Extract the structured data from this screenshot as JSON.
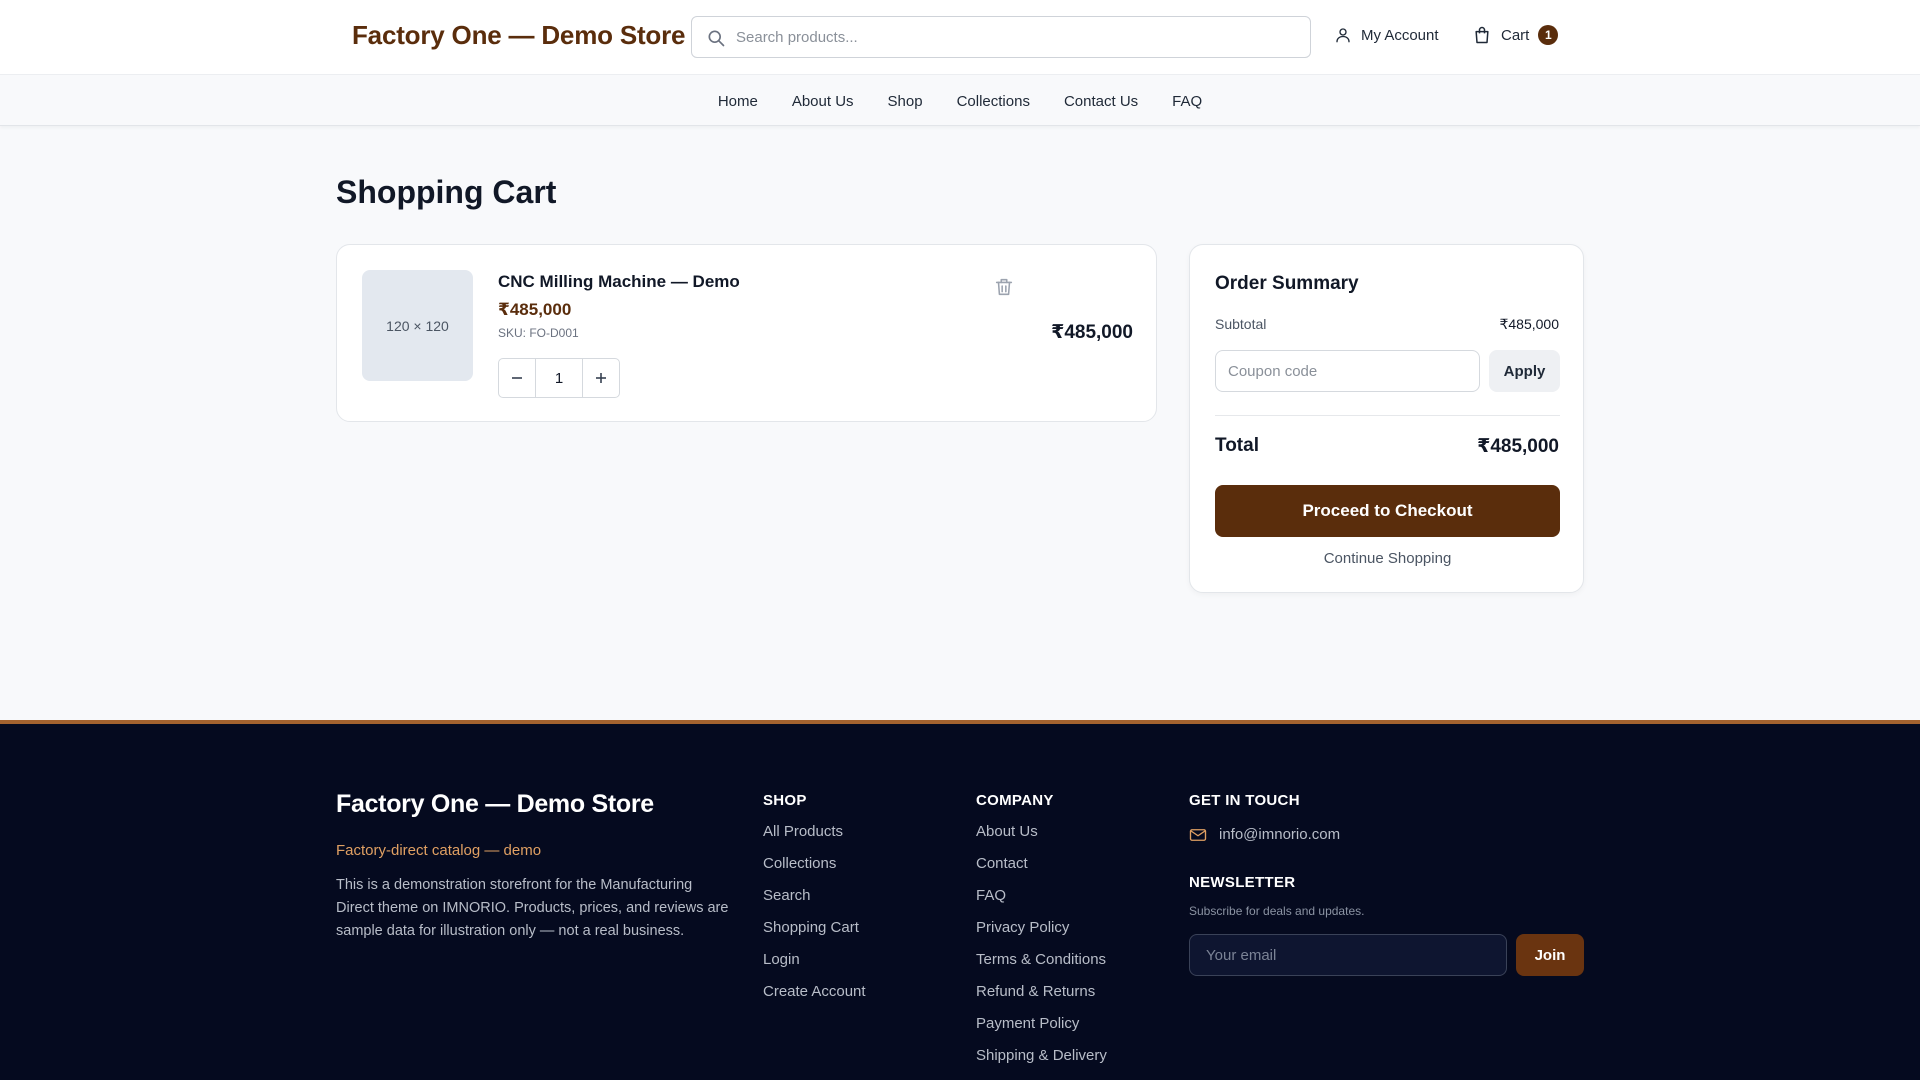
{
  "header": {
    "brand": "Factory One — Demo Store",
    "search_placeholder": "Search products...",
    "account_label": "My Account",
    "cart_label": "Cart",
    "cart_count": "1"
  },
  "nav": {
    "items": [
      {
        "label": "Home"
      },
      {
        "label": "About Us"
      },
      {
        "label": "Shop"
      },
      {
        "label": "Collections"
      },
      {
        "label": "Contact Us"
      },
      {
        "label": "FAQ"
      }
    ]
  },
  "main": {
    "title": "Shopping Cart",
    "cart_item": {
      "image_placeholder": "120 × 120",
      "name": "CNC Milling Machine — Demo",
      "price": "₹485,000",
      "sku": "SKU: FO-D001",
      "quantity": "1",
      "line_total": "₹485,000"
    }
  },
  "summary": {
    "title": "Order Summary",
    "subtotal_label": "Subtotal",
    "subtotal_value": "₹485,000",
    "coupon_placeholder": "Coupon code",
    "apply_label": "Apply",
    "total_label": "Total",
    "total_value": "₹485,000",
    "checkout_label": "Proceed to Checkout",
    "continue_label": "Continue Shopping"
  },
  "footer": {
    "brand": "Factory One — Demo Store",
    "tagline": "Factory-direct catalog — demo",
    "description": "This is a demonstration storefront for the Manufacturing Direct theme on IMNORIO. Products, prices, and reviews are sample data for illustration only — not a real business.",
    "shop": {
      "heading": "SHOP",
      "links": [
        "All Products",
        "Collections",
        "Search",
        "Shopping Cart",
        "Login",
        "Create Account"
      ]
    },
    "company": {
      "heading": "COMPANY",
      "links": [
        "About Us",
        "Contact",
        "FAQ",
        "Privacy Policy",
        "Terms & Conditions",
        "Refund & Returns",
        "Payment Policy",
        "Shipping & Delivery"
      ]
    },
    "contact": {
      "heading": "GET IN TOUCH",
      "email": "info@imnorio.com"
    },
    "newsletter": {
      "heading": "NEWSLETTER",
      "subtitle": "Subscribe for deals and updates.",
      "placeholder": "Your email",
      "button": "Join"
    }
  },
  "colors": {
    "brand": "#5a2d0c",
    "footer_bg": "#050a1f",
    "footer_accent": "#a4632f",
    "tagline": "#e0a063"
  },
  "icons": [
    "search-icon",
    "user-icon",
    "bag-icon",
    "trash-icon",
    "minus-icon",
    "plus-icon",
    "mail-icon"
  ]
}
